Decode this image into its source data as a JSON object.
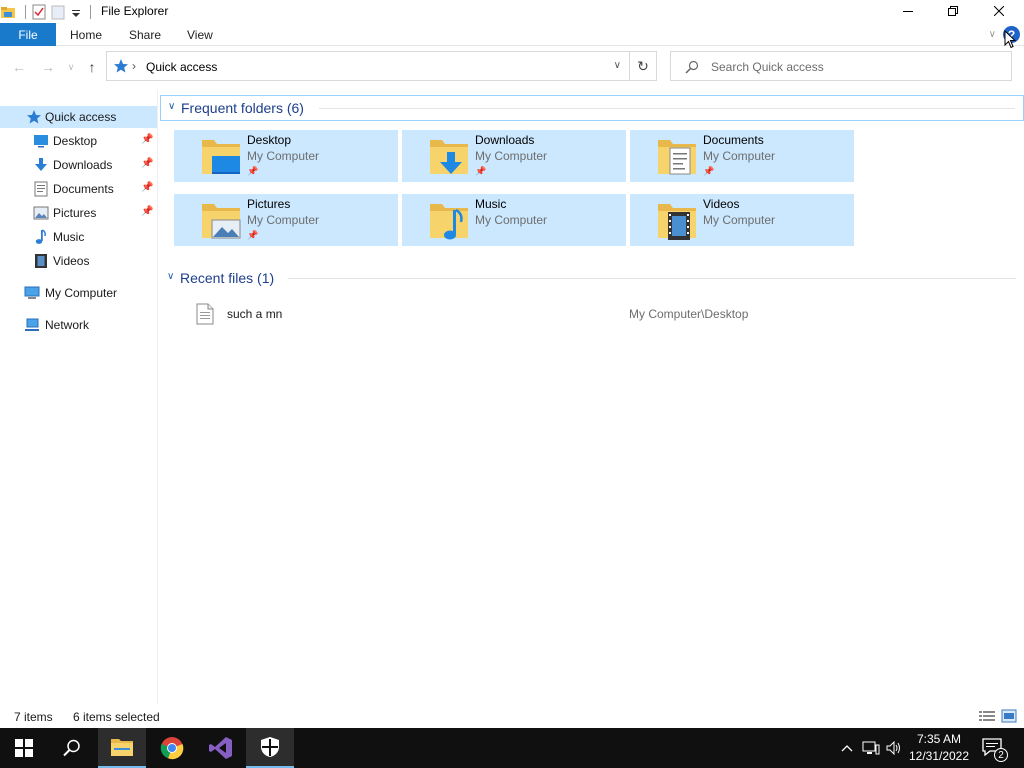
{
  "window": {
    "title": "File Explorer"
  },
  "ribbon": {
    "tabs": [
      "File",
      "Home",
      "Share",
      "View"
    ],
    "help_label": "?"
  },
  "address": {
    "path": "Quick access"
  },
  "search": {
    "placeholder": "Search Quick access"
  },
  "navpane": {
    "quick_access": "Quick access",
    "pinned": [
      {
        "label": "Desktop",
        "icon": "desktop-icon",
        "pinned": true
      },
      {
        "label": "Downloads",
        "icon": "downloads-icon",
        "pinned": true
      },
      {
        "label": "Documents",
        "icon": "documents-icon",
        "pinned": true
      },
      {
        "label": "Pictures",
        "icon": "pictures-icon",
        "pinned": true
      },
      {
        "label": "Music",
        "icon": "music-icon",
        "pinned": false
      },
      {
        "label": "Videos",
        "icon": "videos-icon",
        "pinned": false
      }
    ],
    "my_computer": "My Computer",
    "network": "Network"
  },
  "frequent": {
    "title": "Frequent folders (6)",
    "folders": [
      {
        "name": "Desktop",
        "location": "My Computer",
        "pinned": true
      },
      {
        "name": "Downloads",
        "location": "My Computer",
        "pinned": true
      },
      {
        "name": "Documents",
        "location": "My Computer",
        "pinned": true
      },
      {
        "name": "Pictures",
        "location": "My Computer",
        "pinned": true
      },
      {
        "name": "Music",
        "location": "My Computer",
        "pinned": false
      },
      {
        "name": "Videos",
        "location": "My Computer",
        "pinned": false
      }
    ]
  },
  "recent": {
    "title": "Recent files (1)",
    "files": [
      {
        "name": "such a mn",
        "path": "My Computer\\Desktop"
      }
    ]
  },
  "status": {
    "items": "7 items",
    "selected": "6 items selected"
  },
  "taskbar": {
    "time": "7:35 AM",
    "date": "12/31/2022",
    "notification_count": "2"
  },
  "colors": {
    "selection": "#cce8ff",
    "file_tab": "#1979ca",
    "group_title": "#1e3f8c",
    "taskbar": "#101010"
  }
}
